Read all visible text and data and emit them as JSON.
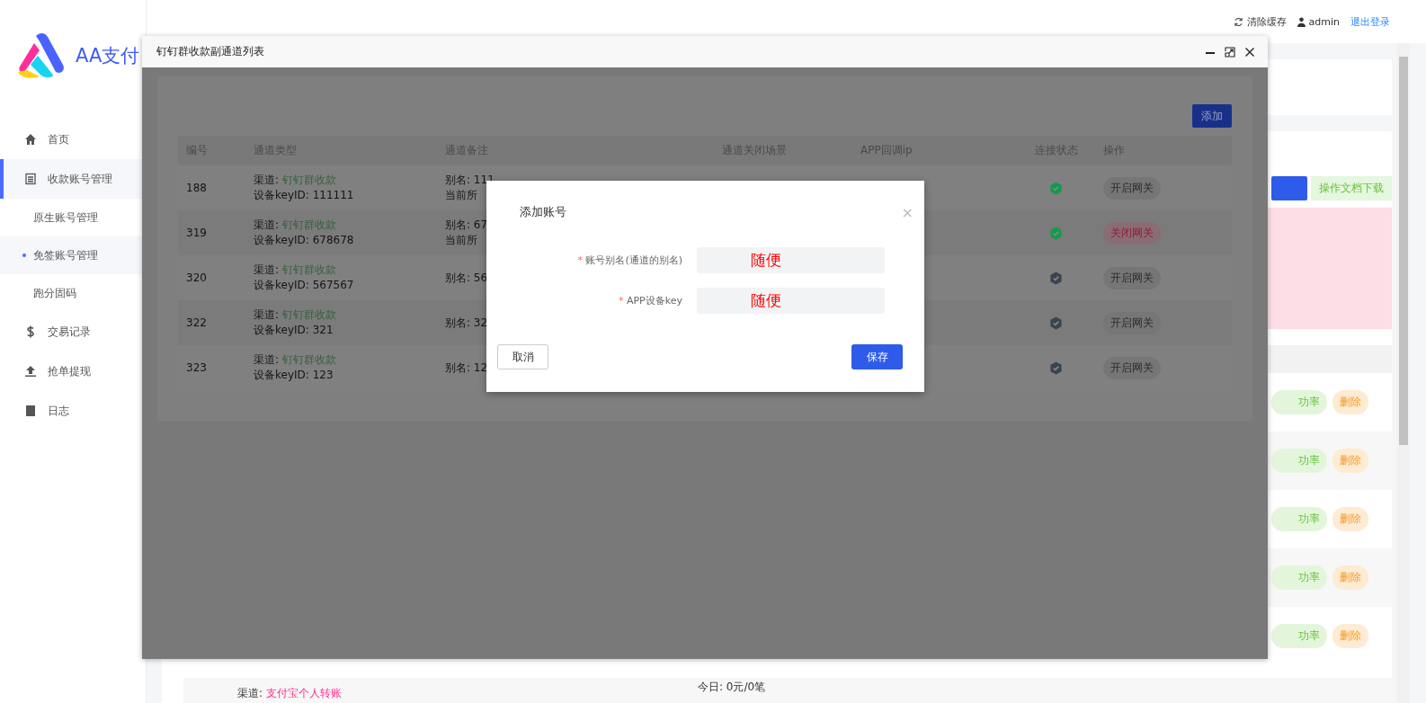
{
  "header": {
    "clear_cache": "清除缓存",
    "user": "admin",
    "logout": "退出登录"
  },
  "sidebar": {
    "logo_text": "AA支付",
    "items": [
      {
        "label": "首页",
        "selected": false
      },
      {
        "label": "收款账号管理",
        "selected": true,
        "children": [
          {
            "label": "原生账号管理",
            "selected": false
          },
          {
            "label": "免签账号管理",
            "selected": true
          },
          {
            "label": "跑分固码",
            "selected": false
          }
        ]
      },
      {
        "label": "交易记录",
        "selected": false
      },
      {
        "label": "抢单提现",
        "selected": false
      },
      {
        "label": "日志",
        "selected": false
      }
    ]
  },
  "background": {
    "doc_button": "操作文档下载",
    "rows": [
      {
        "actions": [
          "功率",
          "删除"
        ]
      },
      {
        "actions": [
          "功率",
          "删除"
        ]
      },
      {
        "actions": [
          "功率",
          "删除"
        ]
      },
      {
        "actions": [
          "功率",
          "删除"
        ]
      },
      {
        "actions": [
          "功率",
          "删除"
        ]
      }
    ],
    "last_row": {
      "channel_label": "渠道:",
      "channel": "支付宝个人转账",
      "today": "今日: 0元/0笔"
    }
  },
  "window": {
    "title": "钉钉群收款副通道列表",
    "add_button": "添加",
    "table": {
      "columns": [
        "编号",
        "通道类型",
        "通道备注",
        "通道关闭场景",
        "APP回调ip",
        "连接状态",
        "操作"
      ],
      "rows": [
        {
          "id": "188",
          "channel_label": "渠道:",
          "channel": "钉钉群收款",
          "device_key": "设备keyID: 111111",
          "remark": [
            "别名: 111",
            "当前所"
          ],
          "connected": true,
          "action": "开启网关",
          "kind": "open"
        },
        {
          "id": "319",
          "channel_label": "渠道:",
          "channel": "钉钉群收款",
          "device_key": "设备keyID: 678678",
          "remark": [
            "别名: 67",
            "当前所"
          ],
          "connected": true,
          "action": "关闭网关",
          "kind": "close"
        },
        {
          "id": "320",
          "channel_label": "渠道:",
          "channel": "钉钉群收款",
          "device_key": "设备keyID: 567567",
          "remark": [
            "别名: 56"
          ],
          "connected": false,
          "action": "开启网关",
          "kind": "open"
        },
        {
          "id": "322",
          "channel_label": "渠道:",
          "channel": "钉钉群收款",
          "device_key": "设备keyID: 321",
          "remark": [
            "别名: 32"
          ],
          "connected": false,
          "action": "开启网关",
          "kind": "open"
        },
        {
          "id": "323",
          "channel_label": "渠道:",
          "channel": "钉钉群收款",
          "device_key": "设备keyID: 123",
          "remark": [
            "别名: 12"
          ],
          "connected": false,
          "action": "开启网关",
          "kind": "open"
        }
      ]
    }
  },
  "dialog": {
    "title": "添加账号",
    "close": "×",
    "fields": [
      {
        "required_mark": "*",
        "label": "账号别名(通道的别名)",
        "value": "随便"
      },
      {
        "required_mark": "*",
        "label": "APP设备key",
        "value": "随便"
      }
    ],
    "cancel": "取消",
    "save": "保存"
  }
}
